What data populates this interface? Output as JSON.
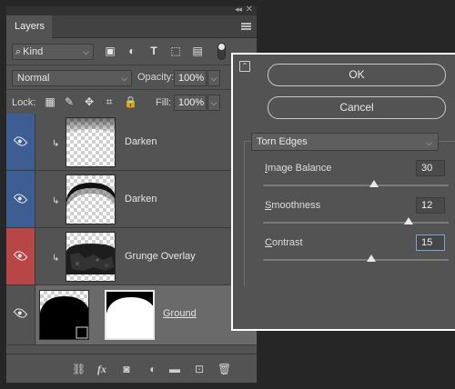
{
  "layers_panel": {
    "tab_label": "Layers",
    "kind_label": "Kind",
    "blend_mode": "Normal",
    "opacity_label": "Opacity:",
    "opacity_value": "100%",
    "lock_label": "Lock:",
    "fill_label": "Fill:",
    "fill_value": "100%",
    "footer_fx_label": "fx",
    "layers": [
      {
        "name": "Darken",
        "visible": true,
        "highlight": "#3d5d93",
        "clipped": true
      },
      {
        "name": "Darken",
        "visible": true,
        "highlight": "#3d5d93",
        "clipped": true
      },
      {
        "name": "Grunge Overlay",
        "visible": true,
        "highlight": "#b84646",
        "clipped": true
      },
      {
        "name": "Ground",
        "visible": true,
        "highlight": "",
        "clipped": false,
        "selected": true
      }
    ]
  },
  "filter_dialog": {
    "ok_label": "OK",
    "cancel_label": "Cancel",
    "filter_name": "Torn Edges",
    "params": [
      {
        "mnemonic": "I",
        "rest": "mage Balance",
        "value": "30",
        "min": 0,
        "max": 50
      },
      {
        "mnemonic": "S",
        "rest": "moothness",
        "value": "12",
        "min": 1,
        "max": 15
      },
      {
        "mnemonic": "C",
        "rest": "ontrast",
        "value": "15",
        "min": 1,
        "max": 25,
        "active": true
      }
    ]
  }
}
